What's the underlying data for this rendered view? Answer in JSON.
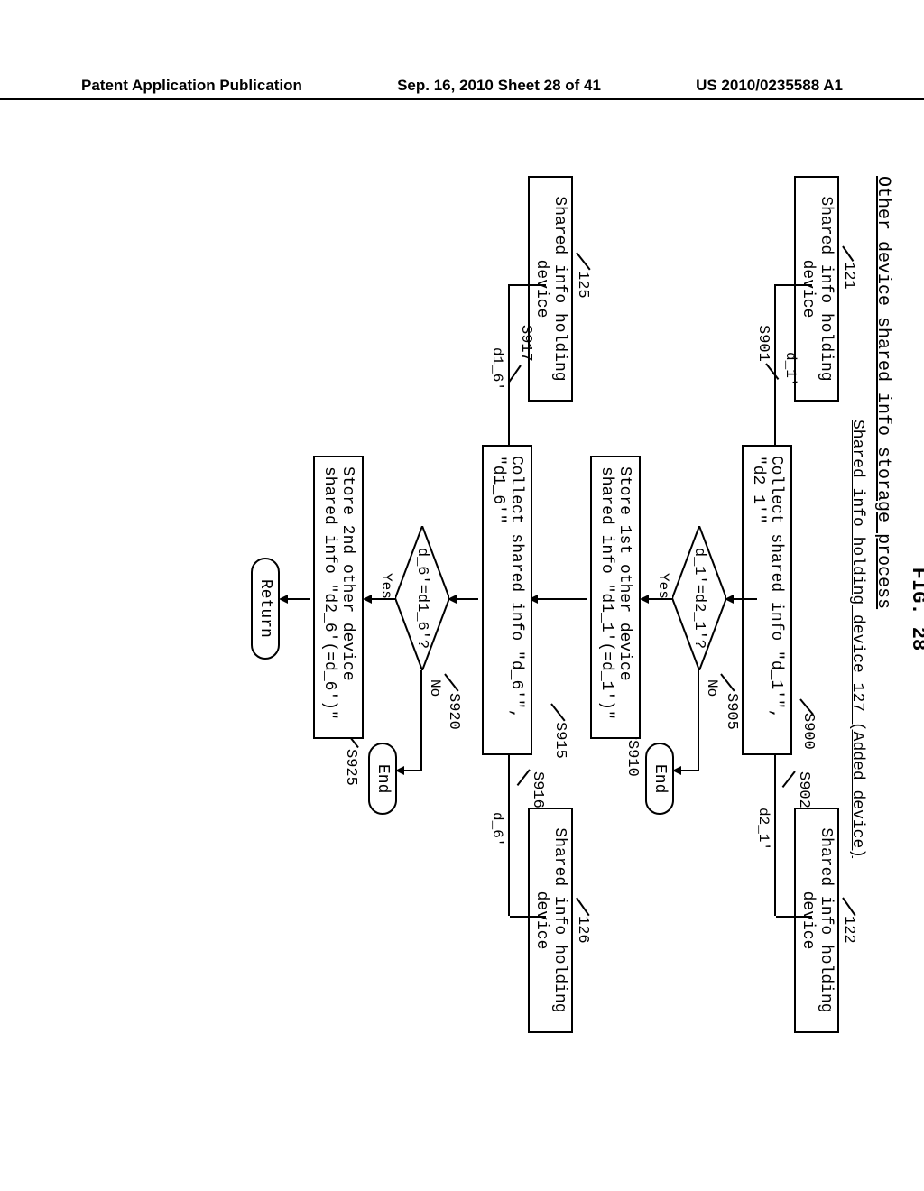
{
  "header": {
    "left": "Patent Application Publication",
    "center": "Sep. 16, 2010  Sheet 28 of 41",
    "right": "US 2010/0235588 A1"
  },
  "fig": {
    "number": "FIG. 28",
    "process_title": "Other device shared info storage process",
    "lane_center_title": "Shared info holding device 127 (Added device)",
    "devices": {
      "d121": {
        "ref": "121",
        "label": "Shared info holding device"
      },
      "d122": {
        "ref": "122",
        "label": "Shared info holding device"
      },
      "d125": {
        "ref": "125",
        "label": "Shared info holding device"
      },
      "d126": {
        "ref": "126",
        "label": "Shared info holding device"
      }
    },
    "steps": {
      "s900": {
        "ref": "S900",
        "text": "Collect shared info \"d_1'\", \"d2_1'\""
      },
      "s901": {
        "ref": "S901",
        "msg": "d_1'"
      },
      "s902": {
        "ref": "S902",
        "msg": "d2_1'"
      },
      "s905": {
        "ref": "S905",
        "text": "d_1'=d2_1'?",
        "yes": "Yes",
        "no": "No"
      },
      "s910": {
        "ref": "S910",
        "text": "Store 1st other device shared info \"d1_1'(=d_1')\""
      },
      "s915": {
        "ref": "S915",
        "text": "Collect shared info \"d_6'\", \"d1_6'\""
      },
      "s916": {
        "ref": "S916",
        "msg": "d_6'"
      },
      "s917": {
        "ref": "S917",
        "msg": "d1_6'"
      },
      "s920": {
        "ref": "S920",
        "text": "d_6'=d1_6'?",
        "yes": "Yes",
        "no": "No"
      },
      "s925": {
        "ref": "S925",
        "text": "Store 2nd other device shared info \"d2_6'(=d_6')\""
      },
      "end1": "End",
      "end2": "End",
      "ret": "Return"
    }
  }
}
